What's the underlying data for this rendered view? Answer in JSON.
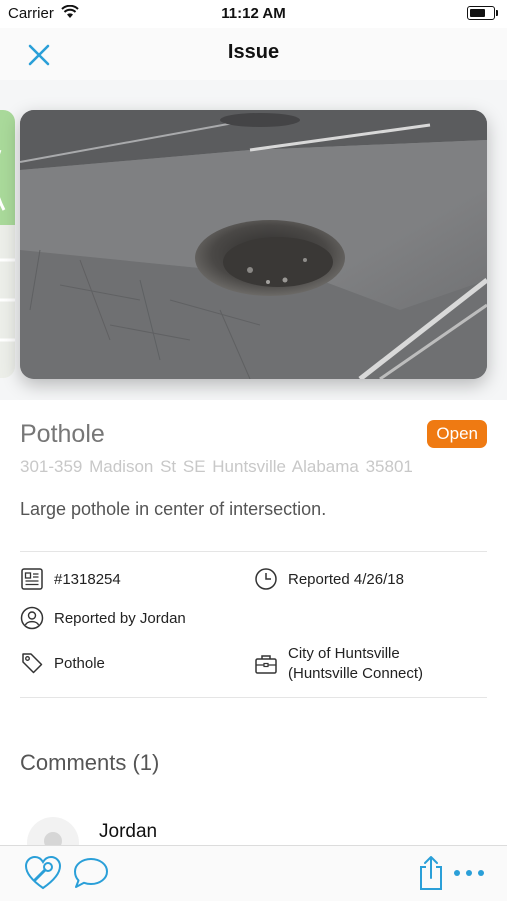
{
  "status_bar": {
    "carrier": "Carrier",
    "time": "11:12 AM"
  },
  "nav": {
    "title": "Issue",
    "close_icon": "close-icon"
  },
  "photo": {
    "subject": "pothole photo"
  },
  "issue": {
    "type": "Pothole",
    "status": "Open",
    "address": "301-359 Madison St SE  Huntsville  Alabama  35801",
    "description": "Large pothole in center of intersection."
  },
  "details": {
    "id": "#1318254",
    "reported_date": "Reported 4/26/18",
    "reported_by": "Reported by Jordan",
    "category": "Pothole",
    "department_line1": "City of Huntsville",
    "department_line2": "(Huntsville Connect)"
  },
  "comments": {
    "heading": "Comments (1)",
    "items": [
      {
        "author": "Jordan"
      }
    ]
  },
  "toolbar": {
    "icons": [
      "heart-wrench-icon",
      "comment-icon",
      "share-icon",
      "more-icon"
    ]
  },
  "colors": {
    "accent": "#2a9fd8",
    "status_open": "#ef7a12",
    "address_gray": "#c8c8c8"
  }
}
